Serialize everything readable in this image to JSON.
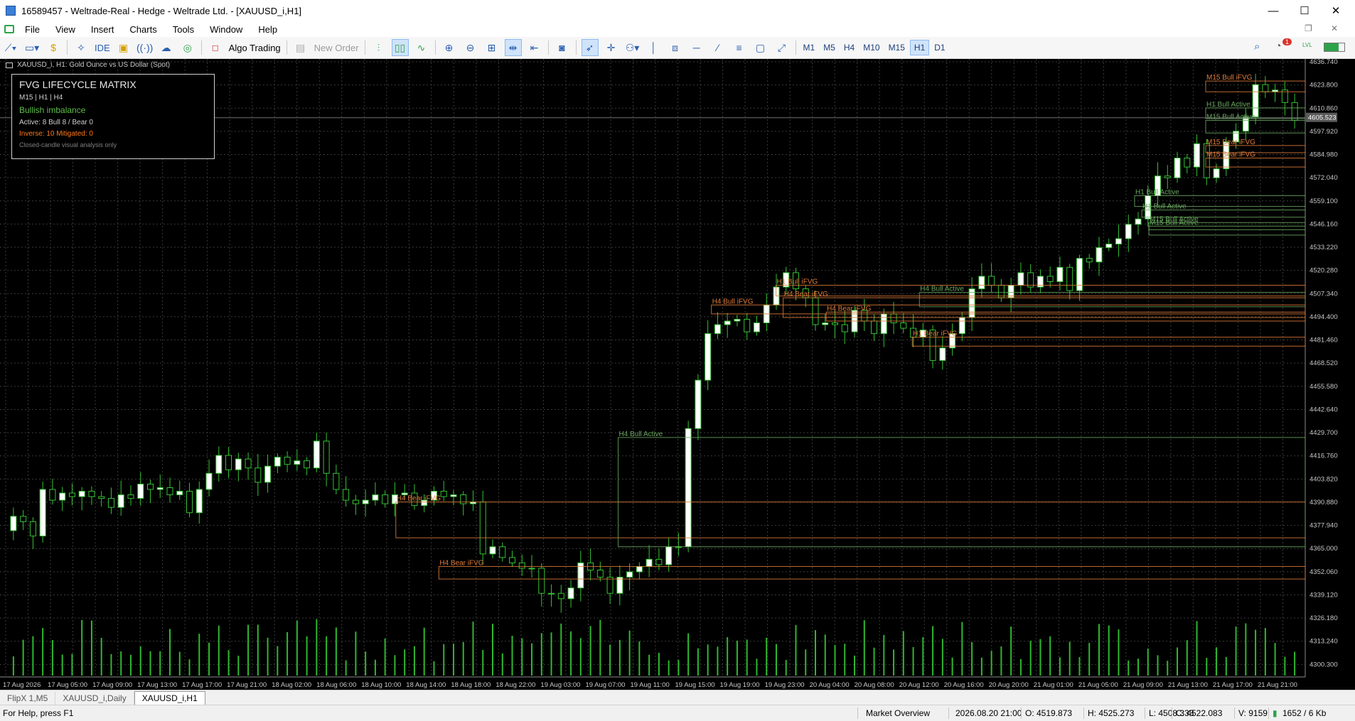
{
  "window": {
    "title": "16589457 - Weltrade-Real - Hedge - Weltrade Ltd. - [XAUUSD_i,H1]",
    "controls": {
      "minimize": "—",
      "maximize": "☐",
      "close": "✕"
    }
  },
  "menu": {
    "items": [
      "File",
      "View",
      "Insert",
      "Charts",
      "Tools",
      "Window",
      "Help"
    ],
    "restore": "❐",
    "close": "✕"
  },
  "toolbar": {
    "ide_label": "IDE",
    "algo_label": "Algo Trading",
    "new_order_label": "New Order",
    "timeframes": [
      "M1",
      "M5",
      "H4",
      "M10",
      "M15",
      "H1",
      "D1"
    ],
    "active_timeframe": "H1",
    "notification_count": "1",
    "lvl_label": "LVL"
  },
  "chart": {
    "header": "XAUUSD_i, H1:  Gold Ounce vs US Dollar (Spot)",
    "panel": {
      "title": "FVG LIFECYCLE MATRIX",
      "timeframes": "M15 | H1 | H4",
      "bias": "Bullish imbalance",
      "active": "Active: 8  Bull 8 / Bear 0",
      "inverse": "Inverse: 10  Mitigated: 0",
      "note": "Closed-candle visual analysis only"
    },
    "current_price": "4605.523"
  },
  "chart_data": {
    "type": "candlestick",
    "symbol": "XAUUSD_i",
    "timeframe": "H1",
    "ylim": [
      4293.31,
      4636.74
    ],
    "y_ticks": [
      "4636.740",
      "4623.800",
      "4610.860",
      "4597.920",
      "4584.980",
      "4572.040",
      "4559.100",
      "4546.160",
      "4533.220",
      "4520.280",
      "4507.340",
      "4494.400",
      "4481.460",
      "4468.520",
      "4455.580",
      "4442.640",
      "4429.700",
      "4416.760",
      "4403.820",
      "4390.880",
      "4377.940",
      "4365.000",
      "4352.060",
      "4339.120",
      "4326.180",
      "4313.240",
      "4300.300"
    ],
    "x_ticks": [
      "17 Aug 2026",
      "17 Aug 05:00",
      "17 Aug 09:00",
      "17 Aug 13:00",
      "17 Aug 17:00",
      "17 Aug 21:00",
      "18 Aug 02:00",
      "18 Aug 06:00",
      "18 Aug 10:00",
      "18 Aug 14:00",
      "18 Aug 18:00",
      "18 Aug 22:00",
      "19 Aug 03:00",
      "19 Aug 07:00",
      "19 Aug 11:00",
      "19 Aug 15:00",
      "19 Aug 19:00",
      "19 Aug 23:00",
      "20 Aug 04:00",
      "20 Aug 08:00",
      "20 Aug 12:00",
      "20 Aug 16:00",
      "20 Aug 20:00",
      "21 Aug 01:00",
      "21 Aug 05:00",
      "21 Aug 09:00",
      "21 Aug 13:00",
      "21 Aug 17:00",
      "21 Aug 21:00"
    ],
    "closes": [
      4383,
      4380,
      4372,
      4398,
      4392,
      4396,
      4394,
      4397,
      4394,
      4393,
      4388,
      4395,
      4393,
      4401,
      4398,
      4399,
      4395,
      4397,
      4385,
      4398,
      4407,
      4417,
      4409,
      4415,
      4410,
      4402,
      4411,
      4416,
      4412,
      4414,
      4410,
      4425,
      4407,
      4398,
      4392,
      4390,
      4392,
      4395,
      4390,
      4395,
      4396,
      4389,
      4392,
      4397,
      4394,
      4395,
      4390,
      4391,
      4362,
      4366,
      4360,
      4357,
      4354,
      4354,
      4340,
      4340,
      4337,
      4343,
      4357,
      4353,
      4349,
      4340,
      4349,
      4352,
      4355,
      4359,
      4356,
      4366,
      4366,
      4432,
      4459,
      4485,
      4490,
      4492,
      4493,
      4486,
      4491,
      4501,
      4511,
      4519,
      4510,
      4505,
      4490,
      4491,
      4490,
      4486,
      4498,
      4492,
      4485,
      4496,
      4491,
      4488,
      4483,
      4487,
      4470,
      4477,
      4485,
      4494,
      4510,
      4517,
      4512,
      4505,
      4512,
      4519,
      4511,
      4517,
      4514,
      4522,
      4509,
      4527,
      4525,
      4533,
      4535,
      4538,
      4546,
      4549,
      4562,
      4573,
      4572,
      4583,
      4578,
      4591,
      4572,
      4577,
      4592,
      4598,
      4606,
      4624,
      4620,
      4621,
      4614,
      4604
    ],
    "fvg_zones": [
      {
        "label": "H4 Bear iFVG",
        "color": "#e07b39"
      },
      {
        "label": "H4 Bear iFVG",
        "color": "#e07b39"
      },
      {
        "label": "H4 Bull Active",
        "color": "#6aa860"
      },
      {
        "label": "H4 Bull iFVG",
        "color": "#e07b39"
      },
      {
        "label": "H1 Bull iFVG",
        "color": "#e07b39"
      },
      {
        "label": "H4 Bear iFVG",
        "color": "#e07b39"
      },
      {
        "label": "H4 Bear iFVG",
        "color": "#e07b39"
      },
      {
        "label": "H4 Bull Active",
        "color": "#6aa860"
      },
      {
        "label": "H1 Bear iFVG",
        "color": "#e07b39"
      },
      {
        "label": "H1 Bull Active",
        "color": "#6aa860"
      },
      {
        "label": "H1 Bull Active",
        "color": "#6aa860"
      },
      {
        "label": "M15 Bull Active",
        "color": "#6aa860"
      },
      {
        "label": "M15 Bull Active",
        "color": "#6aa860"
      },
      {
        "label": "M15 Bear iFVG",
        "color": "#e07b39"
      },
      {
        "label": "M15 Bear iFVG",
        "color": "#e07b39"
      },
      {
        "label": "H1 Bull Active",
        "color": "#6aa860"
      },
      {
        "label": "M15 Bull Active",
        "color": "#6aa860"
      },
      {
        "label": "M15 Bull iFVG",
        "color": "#e07b39"
      }
    ],
    "colors": {
      "up": "#ffffff",
      "down": "#ffffff",
      "wick": "#34c234",
      "volume": "#2fb82f",
      "grid": "#3a3a3a",
      "axis_text": "#c8c8c8"
    }
  },
  "tabs": [
    "FlipX 1,M5",
    "XAUUSD_i,Daily",
    "XAUUSD_i,H1"
  ],
  "active_tab": "XAUUSD_i,H1",
  "status": {
    "help": "For Help, press F1",
    "market": "Market Overview",
    "datetime": "2026.08.20 21:00",
    "open": "O: 4519.873",
    "high": "H: 4525.273",
    "low": "L: 4508.333",
    "close": "C: 4522.083",
    "volume": "V: 9159",
    "traffic": "1652 / 6 Kb"
  }
}
